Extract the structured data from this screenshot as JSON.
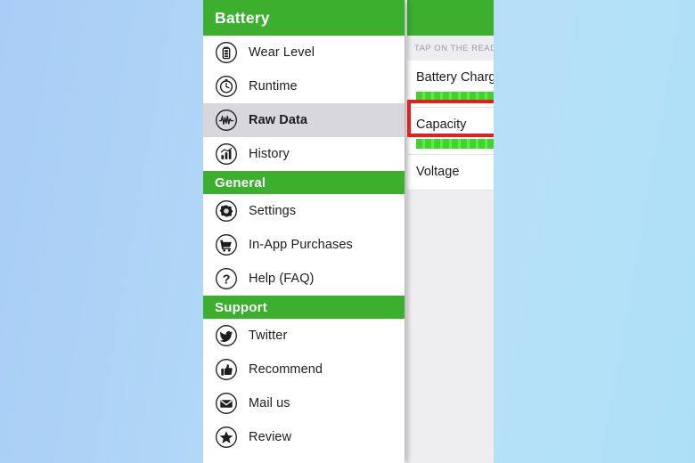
{
  "app": {
    "header_title": "Battery",
    "menu_icon": "list-menu-icon"
  },
  "sidebar": {
    "sections": [
      {
        "title": null,
        "items": [
          {
            "label": "Wear Level",
            "icon": "battery-icon",
            "selected": false
          },
          {
            "label": "Runtime",
            "icon": "clock-icon",
            "selected": false
          },
          {
            "label": "Raw Data",
            "icon": "waveform-icon",
            "selected": true
          },
          {
            "label": "History",
            "icon": "bar-chart-icon",
            "selected": false
          }
        ]
      },
      {
        "title": "General",
        "items": [
          {
            "label": "Settings",
            "icon": "gear-icon",
            "selected": false
          },
          {
            "label": "In-App Purchases",
            "icon": "shopping-cart-icon",
            "selected": false
          },
          {
            "label": "Help (FAQ)",
            "icon": "question-mark-icon",
            "selected": false
          }
        ]
      },
      {
        "title": "Support",
        "items": [
          {
            "label": "Twitter",
            "icon": "twitter-bird-icon",
            "selected": false
          },
          {
            "label": "Recommend",
            "icon": "thumbs-up-icon",
            "selected": false
          },
          {
            "label": "Mail us",
            "icon": "envelope-icon",
            "selected": false
          },
          {
            "label": "Review",
            "icon": "star-icon",
            "selected": false
          }
        ]
      }
    ]
  },
  "right_panel": {
    "hint": "TAP ON THE READ",
    "rows": [
      {
        "title": "Battery Charg",
        "has_bar": true
      },
      {
        "title": "Capacity",
        "has_bar": true
      },
      {
        "title": "Voltage",
        "has_bar": false
      }
    ]
  },
  "annotations": {
    "highlight_color": "#e61e21",
    "arrow": "curved-left-arrow",
    "boxes": [
      {
        "target": "Raw Data"
      },
      {
        "target": "list-menu-icon"
      }
    ]
  },
  "colors": {
    "brand_green": "#3caf2f",
    "bar_green": "#3fd42a",
    "selected_row": "#d8d8dc",
    "annotation_red": "#e61e21",
    "background_blue": "#aed3f6"
  }
}
